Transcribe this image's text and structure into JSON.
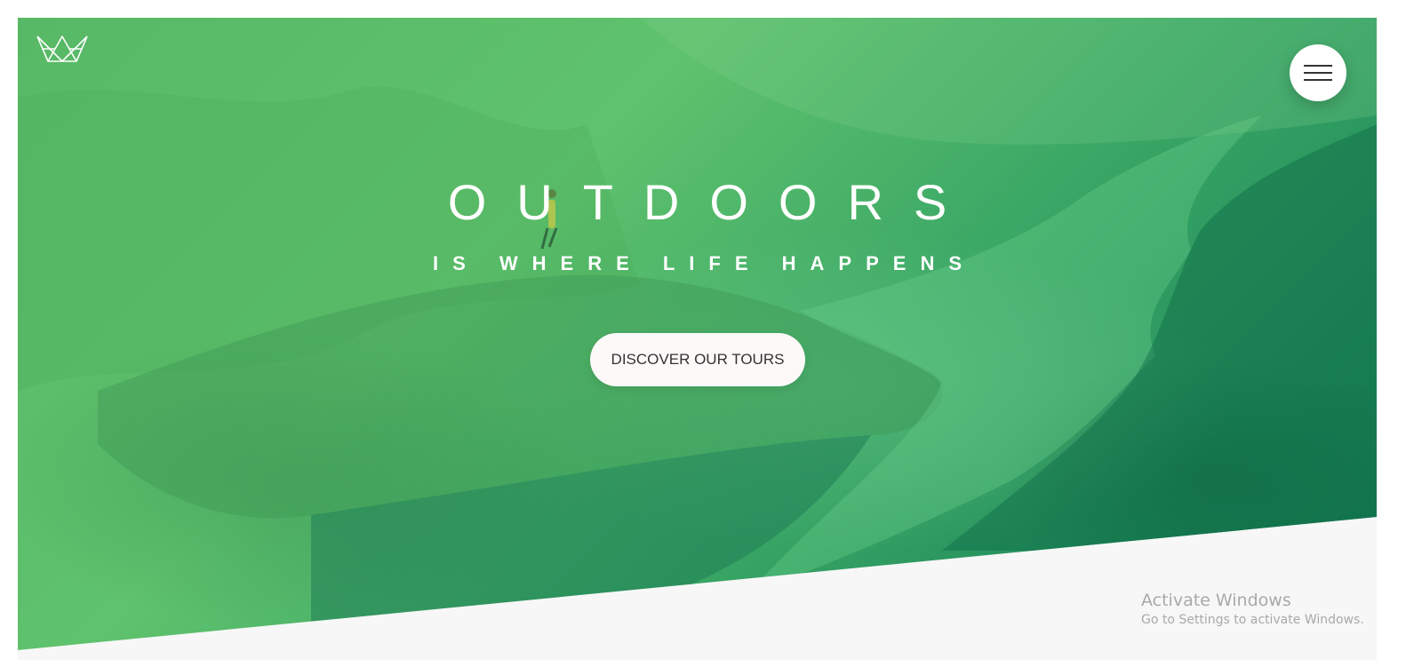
{
  "header": {
    "logo_icon": "crown-icon",
    "menu_icon": "hamburger-icon"
  },
  "hero": {
    "title": "OUTDOORS",
    "subtitle": "IS WHERE LIFE HAPPENS",
    "cta_label": "DISCOVER OUR TOURS",
    "colors": {
      "primary_green": "#55c57a",
      "dark_green": "#28b485",
      "button_bg": "#fdf9f8",
      "text_white": "#ffffff"
    }
  },
  "system_overlay": {
    "activate_title": "Activate Windows",
    "activate_sub": "Go to Settings to activate Windows."
  }
}
